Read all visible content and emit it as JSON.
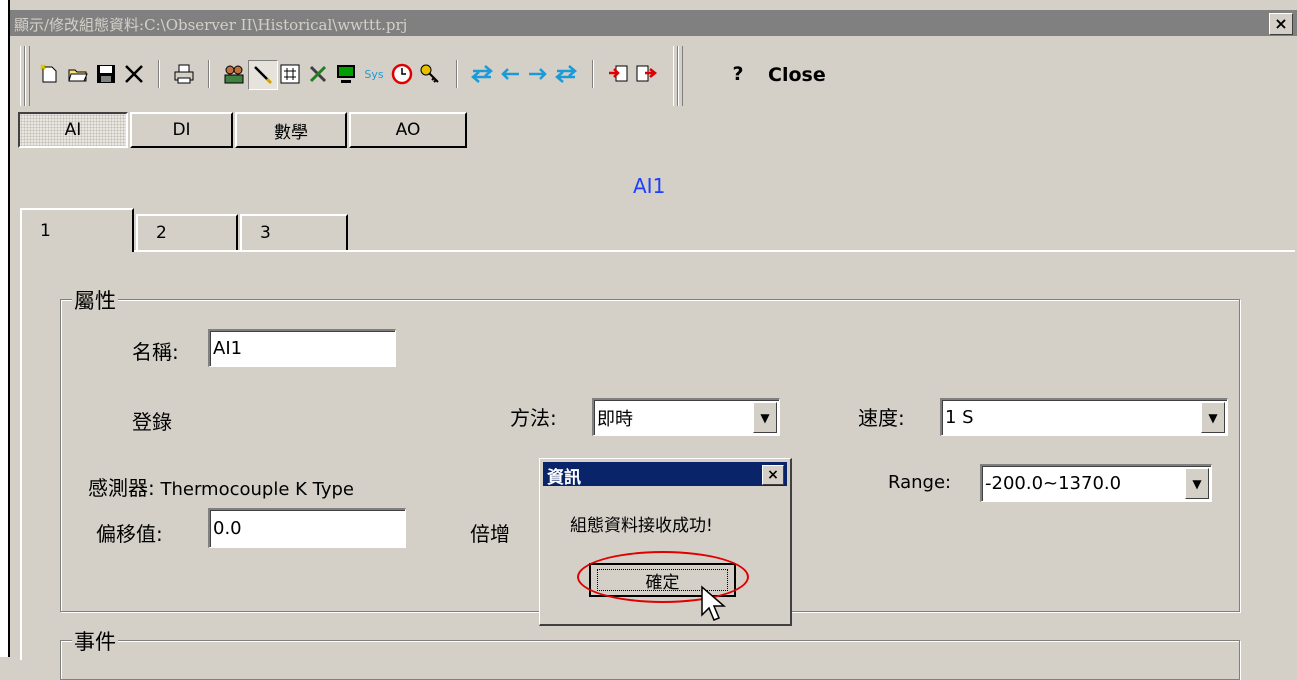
{
  "window": {
    "title": "顯示/修改組態資料:C:\\Observer II\\Historical\\wwttt.prj",
    "close_glyph": "×"
  },
  "toolbar": {
    "icons": [
      "new-file-icon",
      "open-folder-icon",
      "save-disk-icon",
      "delete-x-icon",
      "print-icon",
      "users-icon",
      "pencil-icon",
      "grid-hash-icon",
      "tools-icon",
      "monitor-icon",
      "sys-icon",
      "clock-icon",
      "key-icon",
      "swap-all-icon",
      "arrow-left-icon",
      "arrow-right-icon",
      "swap-all-right-icon",
      "import-icon",
      "export-icon"
    ],
    "sys_label": "Sys",
    "help_label": "?",
    "close_label": "Close",
    "accent": "#1a9bd8"
  },
  "module_tabs": [
    {
      "label": "AI",
      "active": true
    },
    {
      "label": "DI",
      "active": false
    },
    {
      "label": "數學",
      "active": false
    },
    {
      "label": "AO",
      "active": false
    }
  ],
  "channel_heading": "AI1",
  "page_tabs": [
    {
      "label": "1"
    },
    {
      "label": "2"
    },
    {
      "label": "3"
    }
  ],
  "properties": {
    "group_label": "屬性",
    "name_label": "名稱:",
    "name_value": "AI1",
    "logging_label": "登錄",
    "method_label": "方法:",
    "method_value": "即時",
    "speed_label": "速度:",
    "speed_value": "1 S",
    "sensor_label": "感測器:",
    "sensor_value": "Thermocouple K Type",
    "range_label": "Range:",
    "range_value": "-200.0~1370.0",
    "offset_label": "偏移值:",
    "offset_value": "0.0",
    "gain_label": "倍增"
  },
  "events": {
    "group_label": "事件"
  },
  "dialog": {
    "title": "資訊",
    "message": "組態資料接收成功!",
    "ok_label": "確定",
    "close_glyph": "×",
    "title_color": "#0a246a",
    "highlight_color": "#e00000"
  }
}
